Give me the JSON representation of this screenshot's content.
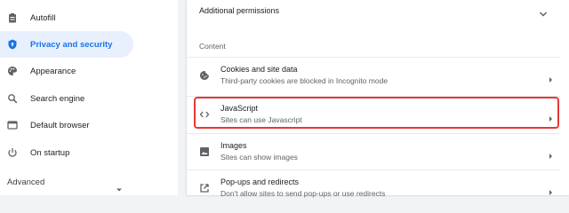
{
  "sidebar": {
    "items": [
      {
        "label": "Autofill",
        "icon": "clipboard-icon"
      },
      {
        "label": "Privacy and security",
        "icon": "shield-icon",
        "active": true
      },
      {
        "label": "Appearance",
        "icon": "palette-icon"
      },
      {
        "label": "Search engine",
        "icon": "search-icon"
      },
      {
        "label": "Default browser",
        "icon": "browser-icon"
      },
      {
        "label": "On startup",
        "icon": "power-icon"
      }
    ],
    "advanced_label": "Advanced"
  },
  "main": {
    "additional_permissions": "Additional permissions",
    "section_title": "Content",
    "rows": [
      {
        "title": "Cookies and site data",
        "subtitle": "Third-party cookies are blocked in Incognito mode",
        "icon": "cookie-icon"
      },
      {
        "title": "JavaScript",
        "subtitle": "Sites can use Javascript",
        "icon": "code-icon"
      },
      {
        "title": "Images",
        "subtitle": "Sites can show images",
        "icon": "image-icon"
      },
      {
        "title": "Pop-ups and redirects",
        "subtitle": "Don't allow sites to send pop-ups or use redirects",
        "icon": "open-in-new-icon"
      }
    ]
  },
  "colors": {
    "accent": "#1a73e8",
    "active_bg": "#e8f0fe",
    "highlight": "#e53935",
    "icon": "#5f6368"
  }
}
